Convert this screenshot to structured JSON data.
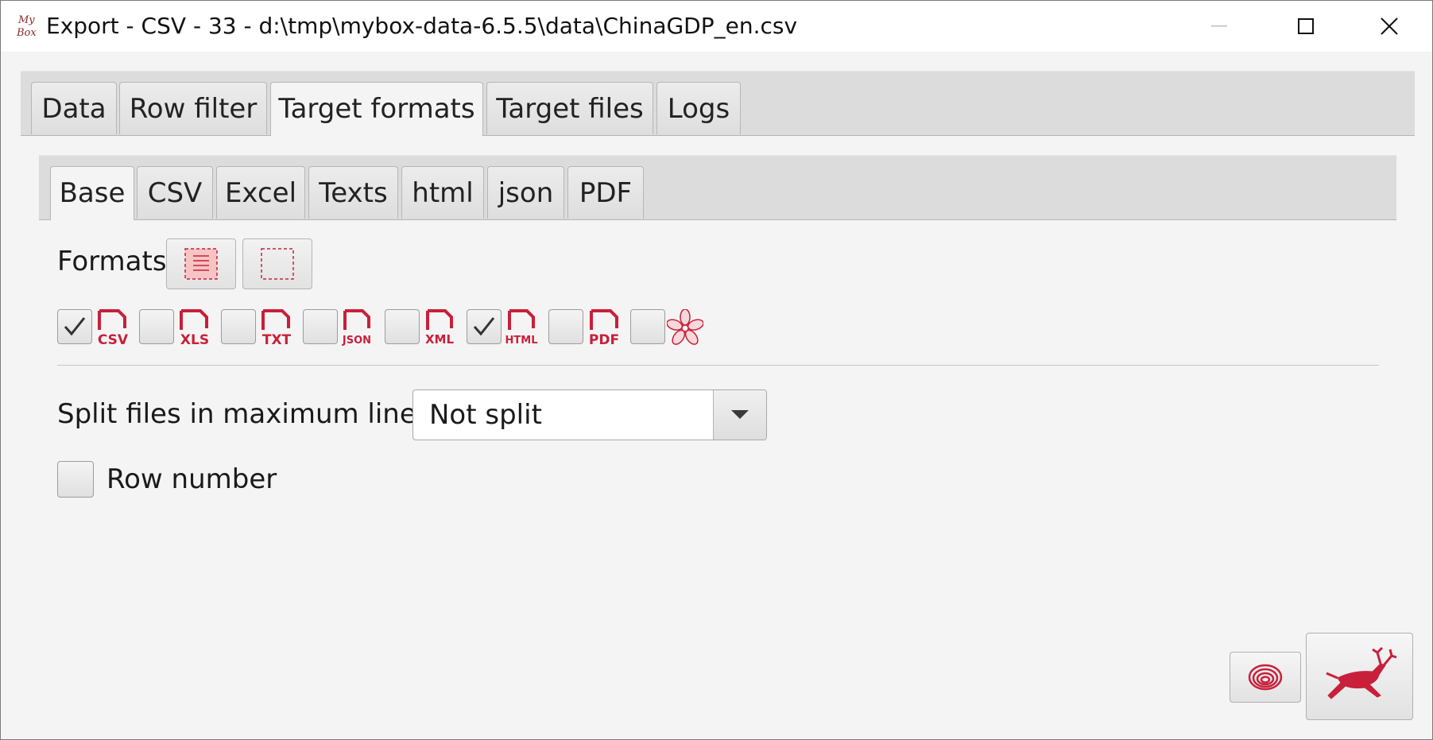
{
  "window": {
    "title": "Export - CSV - 33 - d:\\tmp\\mybox-data-6.5.5\\data\\ChinaGDP_en.csv",
    "app_icon_text": [
      "My",
      "Box"
    ]
  },
  "main_tabs": [
    {
      "label": "Data",
      "active": false
    },
    {
      "label": "Row filter",
      "active": false
    },
    {
      "label": "Target formats",
      "active": true
    },
    {
      "label": "Target files",
      "active": false
    },
    {
      "label": "Logs",
      "active": false
    }
  ],
  "sub_tabs": [
    {
      "label": "Base",
      "active": true
    },
    {
      "label": "CSV",
      "active": false
    },
    {
      "label": "Excel",
      "active": false
    },
    {
      "label": "Texts",
      "active": false
    },
    {
      "label": "html",
      "active": false
    },
    {
      "label": "json",
      "active": false
    },
    {
      "label": "PDF",
      "active": false
    }
  ],
  "formats": {
    "label": "Formats",
    "select_all_icon": "select-all-icon",
    "select_none_icon": "select-none-icon",
    "items": [
      {
        "name": "CSV",
        "checked": true
      },
      {
        "name": "XLS",
        "checked": false
      },
      {
        "name": "TXT",
        "checked": false
      },
      {
        "name": "JSON",
        "checked": false
      },
      {
        "name": "XML",
        "checked": false
      },
      {
        "name": "HTML",
        "checked": true
      },
      {
        "name": "PDF",
        "checked": false
      },
      {
        "name": "",
        "icon": "flower-icon",
        "checked": false
      }
    ]
  },
  "split": {
    "label": "Split files in maximum lines",
    "value": "Not split"
  },
  "row_number": {
    "label": "Row number",
    "checked": false
  },
  "footer": {
    "history_icon": "spiral-icon",
    "start_icon": "running-deer-icon"
  },
  "colors": {
    "accent": "#c8203a",
    "background": "#f4f4f4",
    "tab_bar": "#dcdcdc"
  }
}
